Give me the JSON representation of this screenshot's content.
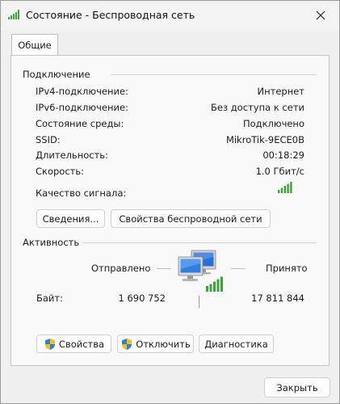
{
  "window": {
    "title": "Состояние - Беспроводная сеть"
  },
  "tabs": [
    {
      "label": "Общие",
      "active": true
    }
  ],
  "connection": {
    "heading": "Подключение",
    "rows": [
      {
        "label": "IPv4-подключение:",
        "value": "Интернет"
      },
      {
        "label": "IPv6-подключение:",
        "value": "Без доступа к сети"
      },
      {
        "label": "Состояние среды:",
        "value": "Подключено"
      },
      {
        "label": "SSID:",
        "value": "MikroTik-9ECE0B"
      },
      {
        "label": "Длительность:",
        "value": "00:18:29"
      },
      {
        "label": "Скорость:",
        "value": "1.0 Гбит/с"
      }
    ],
    "signal_label": "Качество сигнала:",
    "signal_bars": 5,
    "signal_max": 5,
    "details_button": "Сведения...",
    "wireless_props_button": "Свойства беспроводной сети"
  },
  "activity": {
    "heading": "Активность",
    "sent_label": "Отправлено",
    "received_label": "Принято",
    "bytes_label": "Байт:",
    "bytes_sent": "1 690 752",
    "bytes_received": "17 811 844"
  },
  "actions": {
    "properties": "Свойства",
    "disable": "Отключить",
    "diagnose": "Диагностика"
  },
  "footer": {
    "close": "Закрыть"
  },
  "colors": {
    "signal": "#3aa63a",
    "shield_blue": "#2f7fd4",
    "shield_yellow": "#f2c21b"
  },
  "icons": {
    "title": "wireless-signal-icon",
    "activity": "network-computers-icon",
    "shield": "uac-shield-icon",
    "close": "close-icon"
  }
}
